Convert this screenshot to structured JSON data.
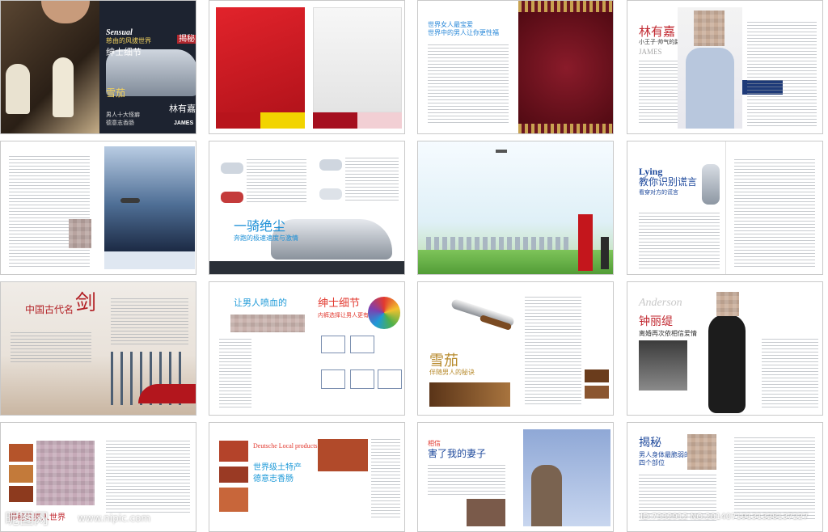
{
  "page": {
    "tiles": {
      "cover": {
        "en_word": "Sensual",
        "line1": "慈由的风拔世界",
        "line2": "绅士细节",
        "mini1": "揭秘",
        "cigar": "雪茄",
        "name": "林有嘉",
        "line3": "男人十大怪癖",
        "line4": "德意志香肠",
        "brand": "JAMES"
      },
      "p1_4": {
        "name": "林有嘉",
        "sub": "小王子·帅气的路上",
        "en": "JAMES"
      },
      "p1_3": {
        "head1": "世界女人最宝爱",
        "head2": "世界中的男人让你更性福"
      },
      "p2_2": {
        "title": "一骑绝尘",
        "sub": "奔跑的极速速度与激情"
      },
      "p2_4": {
        "en": "Lying",
        "title": "教你识别谎言",
        "sub": "看穿对方的谎言"
      },
      "p3_1": {
        "title_a": "中国古代名",
        "title_b": "剑"
      },
      "p3_2": {
        "title_left": "让男人喷血的",
        "title_right": "绅士细节",
        "sub": "内裤选择让男人更有品味"
      },
      "p3_3": {
        "title": "雪茄",
        "sub": "伴随男人的秘诀"
      },
      "p3_4": {
        "en": "Anderson",
        "name": "钟丽缇",
        "sub": "离婚再次依相信爱情"
      },
      "p4_1": {
        "footer": "揭秘的男人世界"
      },
      "p4_2": {
        "en": "Deutsche Local products",
        "title": "世界级土特产",
        "sub": "德意志香肠"
      },
      "p4_3": {
        "kicker": "相信",
        "title": "害了我的妻子"
      },
      "p4_4": {
        "title": "揭秘",
        "sub1": "男人身体最脆弱的",
        "sub2": "四个部位"
      }
    },
    "watermark": {
      "logo": "昵图网",
      "url": "www.nipic.com",
      "id_line": "ID:7332912 NO:20140719131328137227"
    }
  }
}
